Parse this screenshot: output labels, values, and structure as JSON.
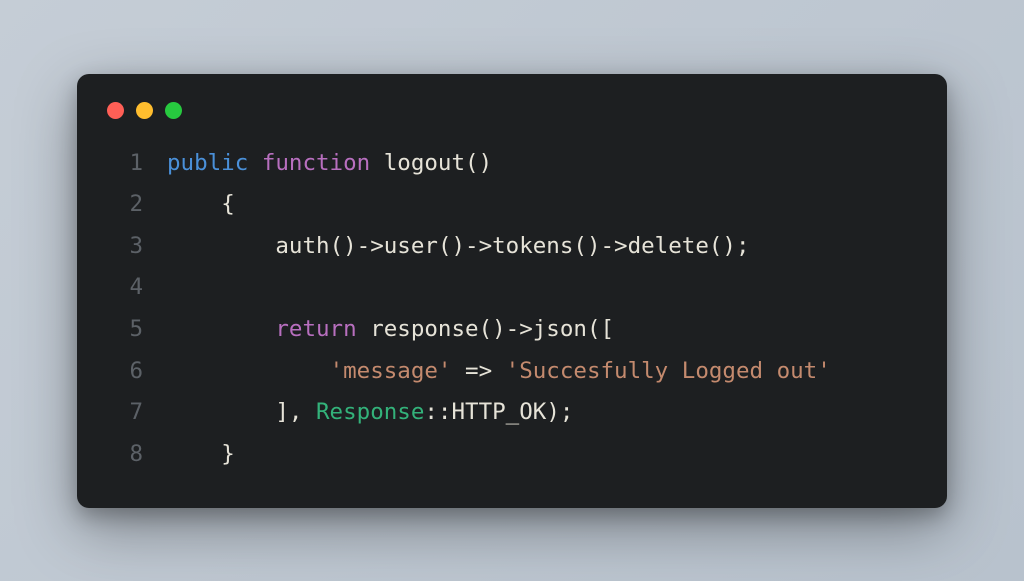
{
  "window": {
    "controls": [
      "close",
      "minimize",
      "zoom"
    ]
  },
  "code": {
    "lines": [
      {
        "n": "1",
        "indent": "",
        "tokens": [
          {
            "t": "public",
            "c": "kw-mod"
          },
          {
            "t": " ",
            "c": "punct"
          },
          {
            "t": "function",
            "c": "kw-func"
          },
          {
            "t": " ",
            "c": "punct"
          },
          {
            "t": "logout",
            "c": "fn-name"
          },
          {
            "t": "()",
            "c": "punct"
          }
        ]
      },
      {
        "n": "2",
        "indent": "    ",
        "tokens": [
          {
            "t": "{",
            "c": "punct"
          }
        ]
      },
      {
        "n": "3",
        "indent": "        ",
        "tokens": [
          {
            "t": "auth",
            "c": "call"
          },
          {
            "t": "()->",
            "c": "punct"
          },
          {
            "t": "user",
            "c": "call"
          },
          {
            "t": "()->",
            "c": "punct"
          },
          {
            "t": "tokens",
            "c": "call"
          },
          {
            "t": "()->",
            "c": "punct"
          },
          {
            "t": "delete",
            "c": "call"
          },
          {
            "t": "();",
            "c": "punct"
          }
        ]
      },
      {
        "n": "4",
        "indent": "",
        "tokens": []
      },
      {
        "n": "5",
        "indent": "        ",
        "tokens": [
          {
            "t": "return",
            "c": "kw-func"
          },
          {
            "t": " ",
            "c": "punct"
          },
          {
            "t": "response",
            "c": "call"
          },
          {
            "t": "()->",
            "c": "punct"
          },
          {
            "t": "json",
            "c": "call"
          },
          {
            "t": "([",
            "c": "punct"
          }
        ]
      },
      {
        "n": "6",
        "indent": "            ",
        "tokens": [
          {
            "t": "'message'",
            "c": "string"
          },
          {
            "t": " => ",
            "c": "arrow"
          },
          {
            "t": "'Succesfully Logged out'",
            "c": "string"
          }
        ]
      },
      {
        "n": "7",
        "indent": "        ",
        "tokens": [
          {
            "t": "], ",
            "c": "punct"
          },
          {
            "t": "Response",
            "c": "classref"
          },
          {
            "t": "::",
            "c": "punct"
          },
          {
            "t": "HTTP_OK",
            "c": "constref"
          },
          {
            "t": ");",
            "c": "punct"
          }
        ]
      },
      {
        "n": "8",
        "indent": "    ",
        "tokens": [
          {
            "t": "}",
            "c": "punct"
          }
        ]
      }
    ]
  }
}
